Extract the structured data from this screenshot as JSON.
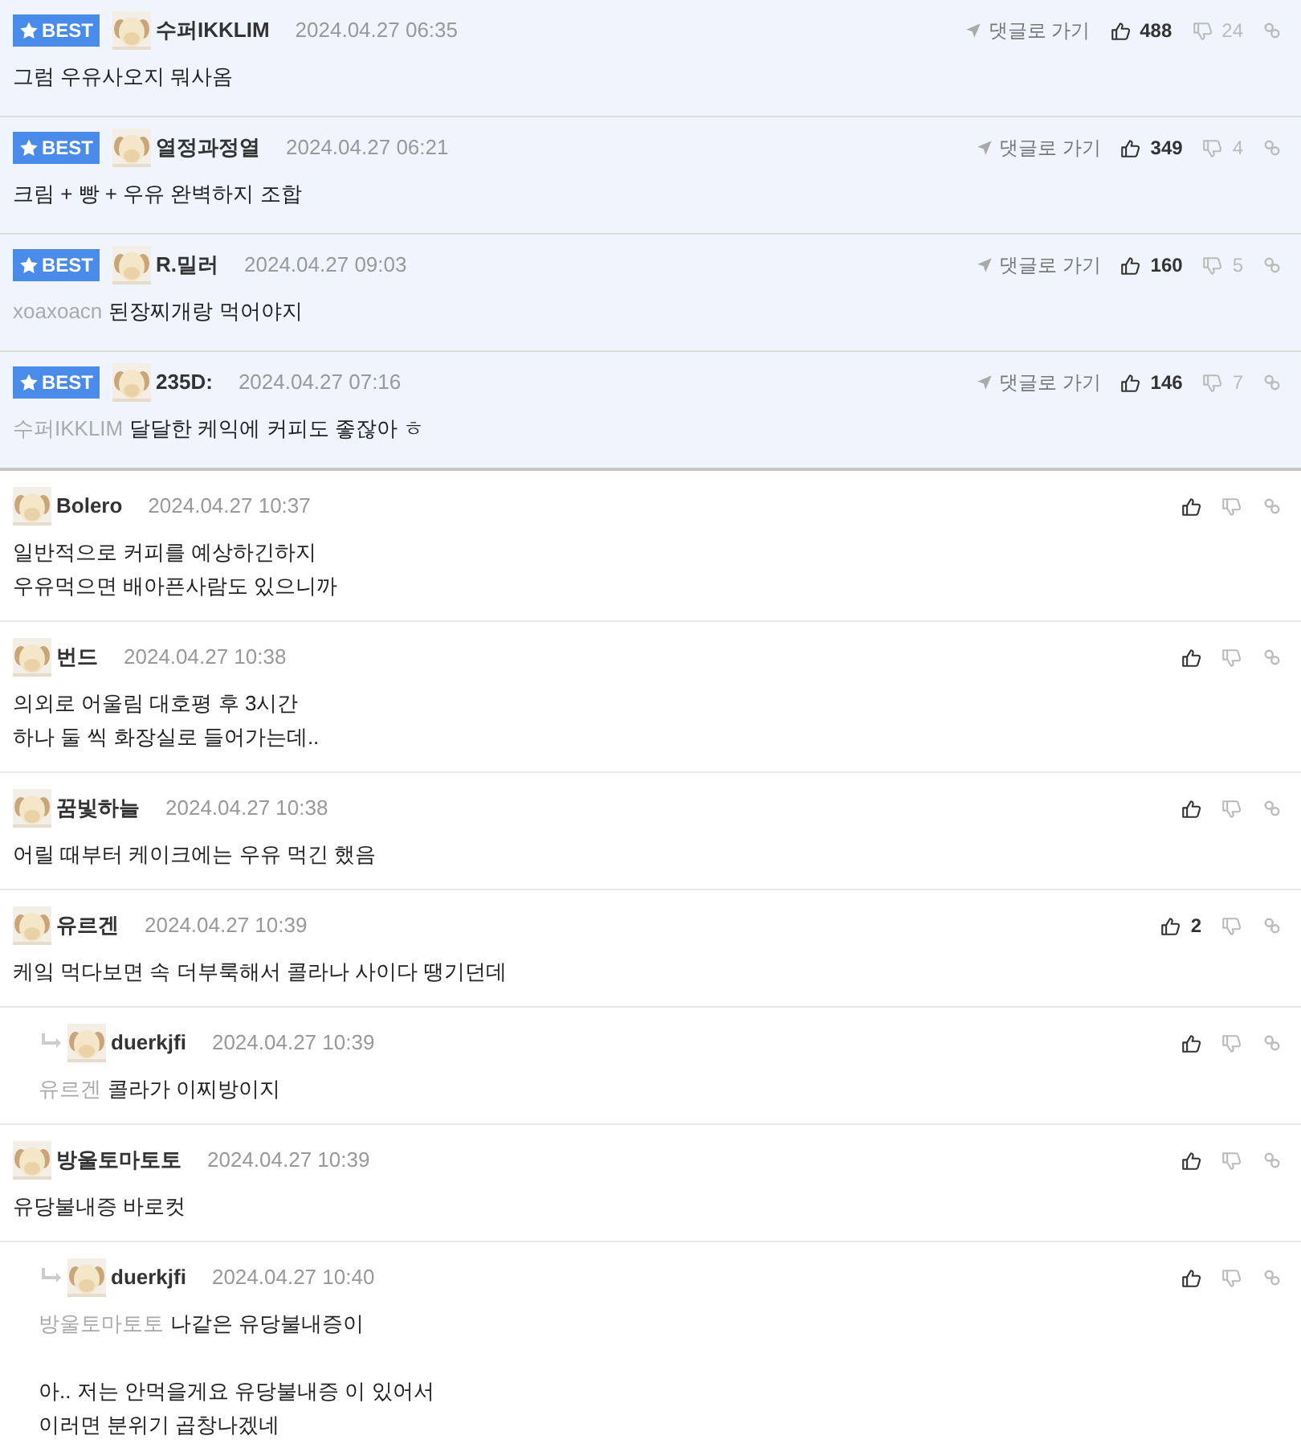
{
  "best_comments": [
    {
      "badge": "BEST",
      "author": "수퍼IKKLIM",
      "time": "2024.04.27 06:35",
      "goto": "댓글로 가기",
      "likes": "488",
      "dislikes": "24",
      "paragraphs": [
        {
          "lines": [
            "그럼 우유사오지 뭐사옴"
          ]
        }
      ]
    },
    {
      "badge": "BEST",
      "author": "열정과정열",
      "time": "2024.04.27 06:21",
      "goto": "댓글로 가기",
      "likes": "349",
      "dislikes": "4",
      "paragraphs": [
        {
          "lines": [
            "크림 + 빵 + 우유 완벽하지 조합"
          ]
        }
      ]
    },
    {
      "badge": "BEST",
      "author": "R.밀러",
      "time": "2024.04.27 09:03",
      "goto": "댓글로 가기",
      "likes": "160",
      "dislikes": "5",
      "mention": "xoaxoacn",
      "paragraphs": [
        {
          "lines": [
            "된장찌개랑 먹어야지"
          ]
        }
      ]
    },
    {
      "badge": "BEST",
      "author": "235D:",
      "time": "2024.04.27 07:16",
      "goto": "댓글로 가기",
      "likes": "146",
      "dislikes": "7",
      "mention": "수퍼IKKLIM",
      "paragraphs": [
        {
          "lines": [
            "달달한 케익에 커피도 좋잖아 ㅎ"
          ]
        }
      ]
    }
  ],
  "comments": [
    {
      "reply": false,
      "author": "Bolero",
      "time": "2024.04.27 10:37",
      "paragraphs": [
        {
          "lines": [
            "일반적으로 커피를 예상하긴하지",
            "우유먹으면 배아픈사람도 있으니까"
          ]
        }
      ]
    },
    {
      "reply": false,
      "author": "번드",
      "time": "2024.04.27 10:38",
      "paragraphs": [
        {
          "lines": [
            "의외로 어울림 대호평 후 3시간",
            "하나 둘 씩 화장실로 들어가는데.."
          ]
        }
      ]
    },
    {
      "reply": false,
      "author": "꿈빛하늘",
      "time": "2024.04.27 10:38",
      "paragraphs": [
        {
          "lines": [
            "어릴 때부터 케이크에는 우유 먹긴 했음"
          ]
        }
      ]
    },
    {
      "reply": false,
      "author": "유르겐",
      "time": "2024.04.27 10:39",
      "likes": "2",
      "paragraphs": [
        {
          "lines": [
            "케잌 먹다보면 속 더부룩해서 콜라나 사이다 땡기던데"
          ]
        }
      ]
    },
    {
      "reply": true,
      "author": "duerkjfi",
      "time": "2024.04.27 10:39",
      "mention": "유르겐",
      "paragraphs": [
        {
          "lines": [
            "콜라가 이찌방이지"
          ]
        }
      ]
    },
    {
      "reply": false,
      "author": "방울토마토토",
      "time": "2024.04.27 10:39",
      "paragraphs": [
        {
          "lines": [
            "유당불내증 바로컷"
          ]
        }
      ]
    },
    {
      "reply": true,
      "author": "duerkjfi",
      "time": "2024.04.27 10:40",
      "mention": "방울토마토토",
      "paragraphs": [
        {
          "lines": [
            "나같은 유당불내증이"
          ]
        },
        {
          "lines": [
            "아.. 저는 안먹을게요 유당불내증 이 있어서",
            "이러면 분위기 곱창나겠네"
          ]
        }
      ]
    }
  ]
}
